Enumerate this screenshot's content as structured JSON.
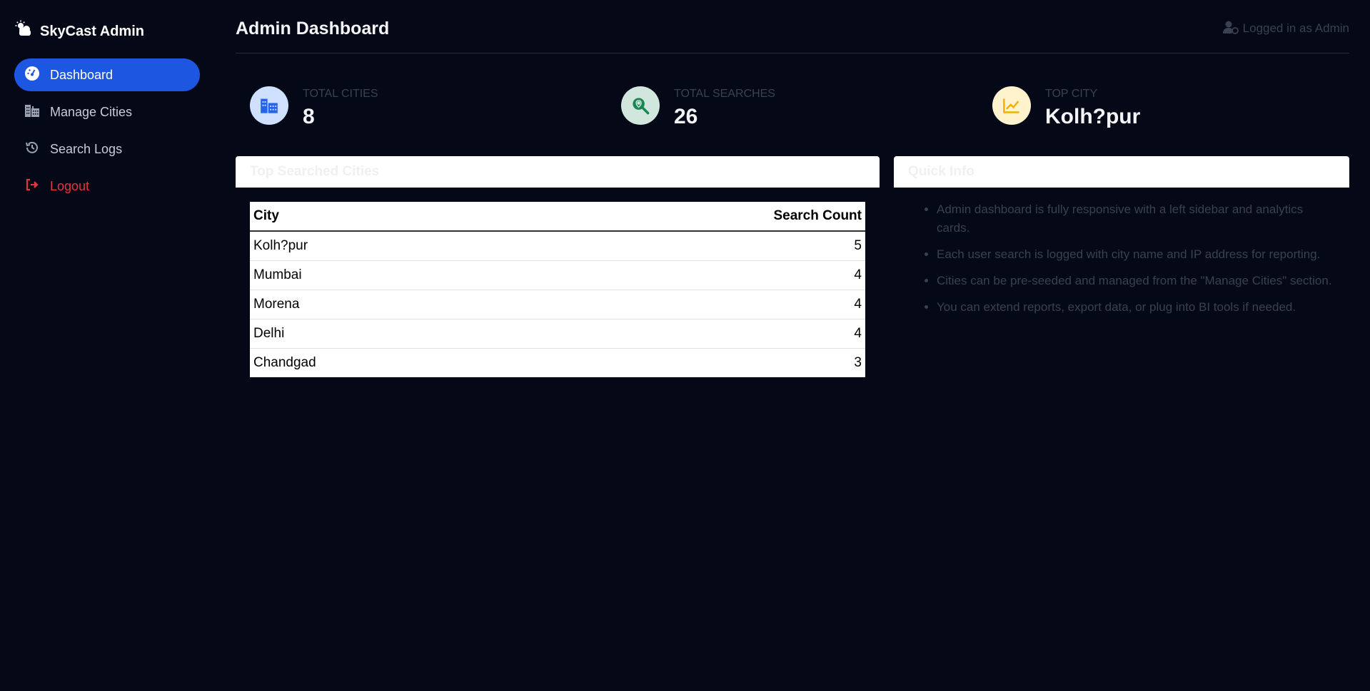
{
  "sidebar": {
    "brand": "SkyCast Admin",
    "items": [
      {
        "label": "Dashboard",
        "icon": "gauge-icon",
        "active": true
      },
      {
        "label": "Manage Cities",
        "icon": "city-icon"
      },
      {
        "label": "Search Logs",
        "icon": "history-icon"
      },
      {
        "label": "Logout",
        "icon": "logout-icon"
      }
    ]
  },
  "header": {
    "title": "Admin Dashboard",
    "user_status": "Logged in as Admin"
  },
  "stats": [
    {
      "label": "TOTAL CITIES",
      "value": "8",
      "icon": "city-icon",
      "color": "#cfe0ff"
    },
    {
      "label": "TOTAL SEARCHES",
      "value": "26",
      "icon": "search-location-icon",
      "color": "#d1e7dd"
    },
    {
      "label": "TOP CITY",
      "value": "Kolh?pur",
      "icon": "chart-line-icon",
      "color": "#fff3cd"
    }
  ],
  "top_cities": {
    "title": "Top Searched Cities",
    "columns": [
      "City",
      "Search Count"
    ],
    "rows": [
      [
        "Kolh?pur",
        "5"
      ],
      [
        "Mumbai",
        "4"
      ],
      [
        "Morena",
        "4"
      ],
      [
        "Delhi",
        "4"
      ],
      [
        "Chandgad",
        "3"
      ]
    ]
  },
  "quick_info": {
    "title": "Quick Info",
    "items": [
      "Admin dashboard is fully responsive with a left sidebar and analytics cards.",
      "Each user search is logged with city name and IP address for reporting.",
      "Cities can be pre-seeded and managed from the \"Manage Cities\" section.",
      "You can extend reports, export data, or plug into BI tools if needed."
    ]
  },
  "colors": {
    "background": "#040817",
    "accent": "#1d56e0",
    "logout": "#e5343f"
  }
}
